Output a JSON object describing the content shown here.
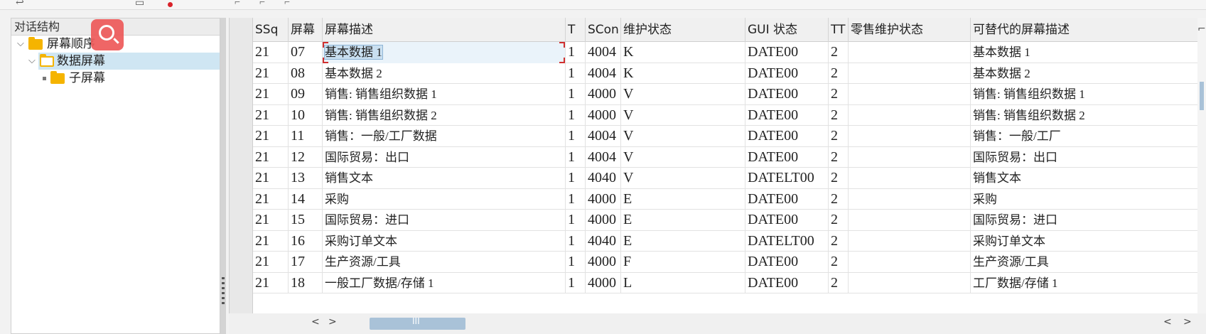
{
  "tree": {
    "header": "对话结构",
    "items": [
      {
        "label": "屏幕顺序",
        "level": 0,
        "expanded": true
      },
      {
        "label": "数据屏幕",
        "level": 1,
        "expanded": true,
        "selected": true
      },
      {
        "label": "子屏幕",
        "level": 2
      }
    ]
  },
  "grid": {
    "columns": [
      "SSq",
      "屏幕",
      "屏幕描述",
      "T",
      "SCon",
      "维护状态",
      "GUI 状态",
      "TT",
      "零售维护状态",
      "可替代的屏幕描述"
    ],
    "rows": [
      [
        "21",
        "07",
        "基本数据 1",
        "1",
        "4004",
        "K",
        "DATE00",
        "2",
        "",
        "基本数据 1"
      ],
      [
        "21",
        "08",
        "基本数据 2",
        "1",
        "4004",
        "K",
        "DATE00",
        "2",
        "",
        "基本数据 2"
      ],
      [
        "21",
        "09",
        "销售: 销售组织数据 1",
        "1",
        "4000",
        "V",
        "DATE00",
        "2",
        "",
        "销售: 销售组织数据 1"
      ],
      [
        "21",
        "10",
        "销售: 销售组织数据 2",
        "1",
        "4000",
        "V",
        "DATE00",
        "2",
        "",
        "销售: 销售组织数据 2"
      ],
      [
        "21",
        "11",
        "销售：一般/工厂数据",
        "1",
        "4004",
        "V",
        "DATE00",
        "2",
        "",
        "销售：一般/工厂"
      ],
      [
        "21",
        "12",
        "国际贸易：出口",
        "1",
        "4004",
        "V",
        "DATE00",
        "2",
        "",
        "国际贸易：出口"
      ],
      [
        "21",
        "13",
        "销售文本",
        "1",
        "4040",
        "V",
        "DATELT00",
        "2",
        "",
        "销售文本"
      ],
      [
        "21",
        "14",
        "采购",
        "1",
        "4000",
        "E",
        "DATE00",
        "2",
        "",
        "采购"
      ],
      [
        "21",
        "15",
        "国际贸易：进口",
        "1",
        "4000",
        "E",
        "DATE00",
        "2",
        "",
        "国际贸易：进口"
      ],
      [
        "21",
        "16",
        "采购订单文本",
        "1",
        "4040",
        "E",
        "DATELT00",
        "2",
        "",
        "采购订单文本"
      ],
      [
        "21",
        "17",
        "生产资源/工具",
        "1",
        "4000",
        "F",
        "DATE00",
        "2",
        "",
        "生产资源/工具"
      ],
      [
        "21",
        "18",
        "一般工厂数据/存储 1",
        "1",
        "4000",
        "L",
        "DATE00",
        "2",
        "",
        "工厂数据/存储 1"
      ]
    ],
    "active_cell": {
      "row": 0,
      "col": 2
    }
  },
  "colors": {
    "selection": "#cfe6f3",
    "accent": "#ee5a5a",
    "folder": "#f5b400"
  },
  "icons": [
    "search-icon",
    "folder-icon",
    "folder-open-icon",
    "chevron-down-icon",
    "scroll-left-icon",
    "scroll-right-icon",
    "settings-icon"
  ],
  "hscroll": {
    "left": "<",
    "right": ">",
    "thumb_grip": "III"
  }
}
